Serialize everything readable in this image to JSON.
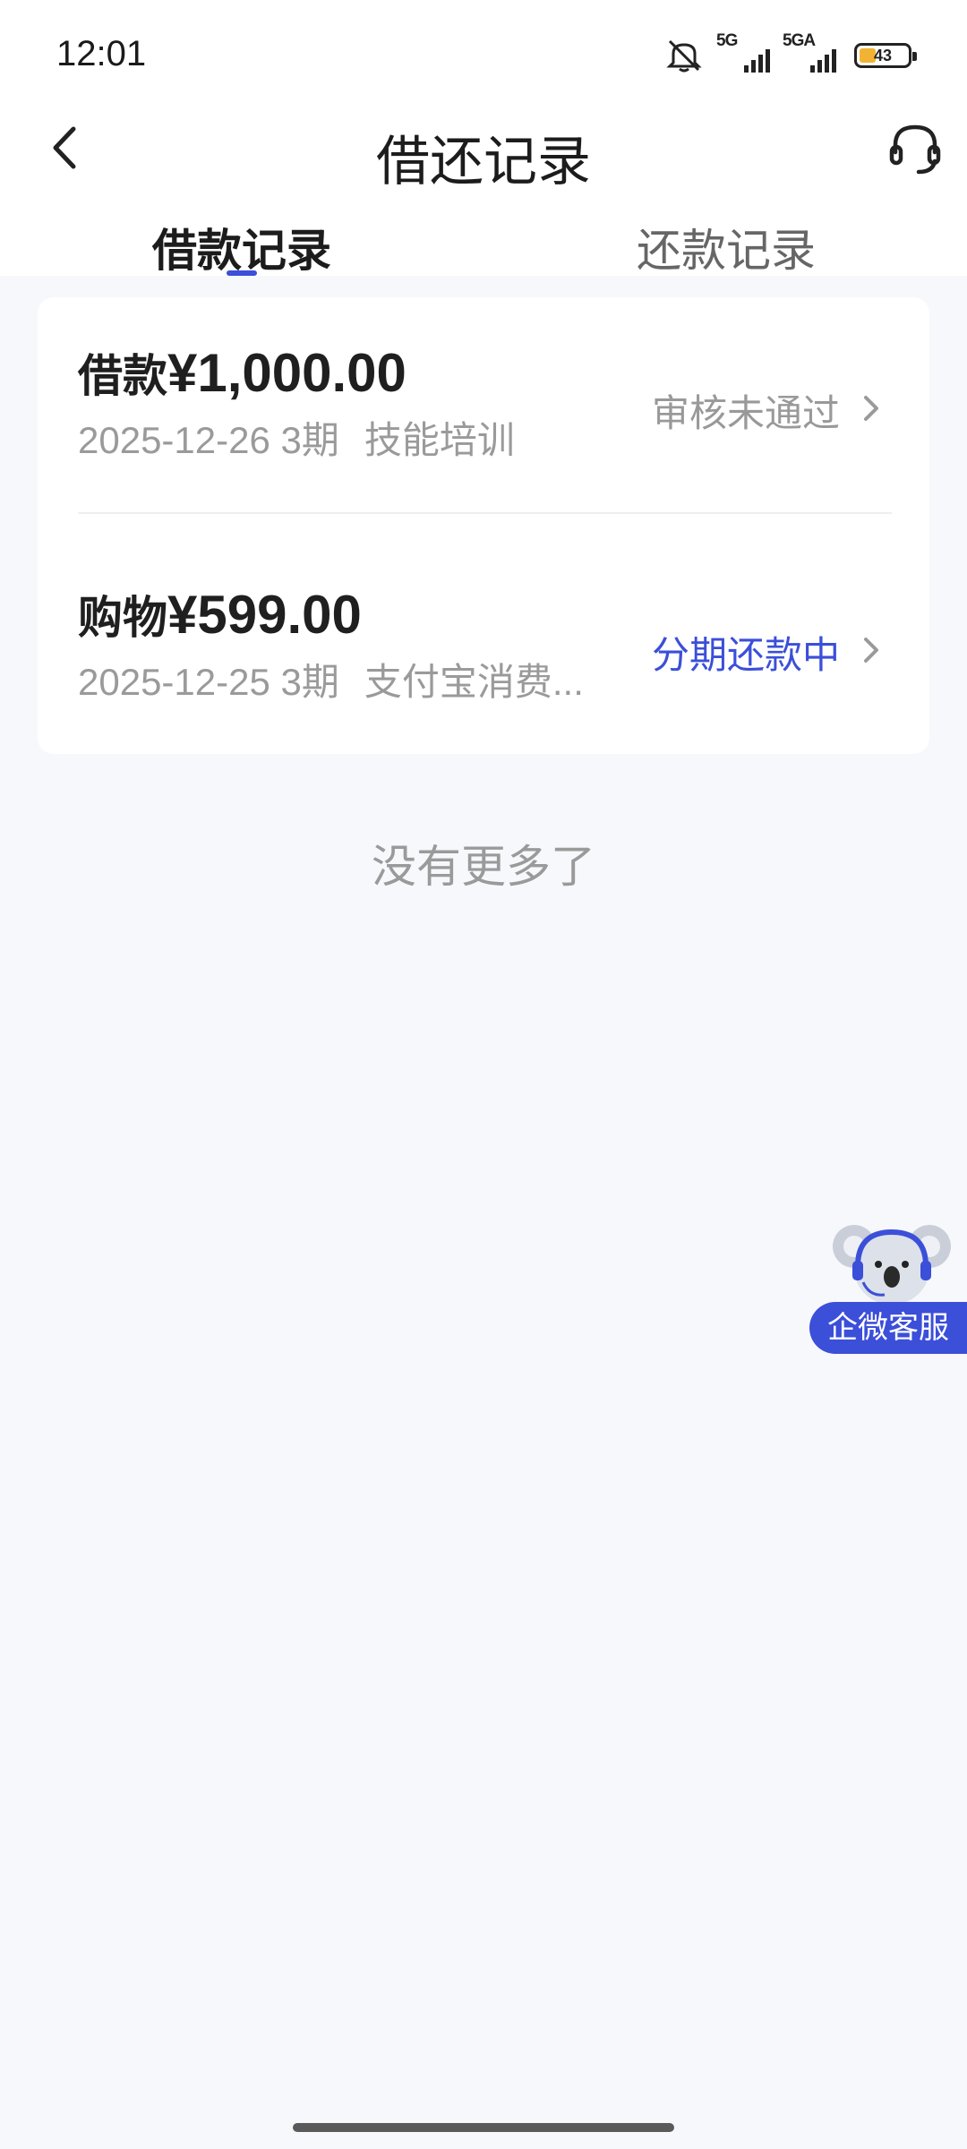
{
  "status_bar": {
    "time": "12:01",
    "network_1": "5G",
    "network_2": "5GA",
    "battery": "43",
    "icons": [
      "mute-icon",
      "signal-icon",
      "battery-icon"
    ]
  },
  "header": {
    "title": "借还记录",
    "back_icon": "chevron-left-icon",
    "service_icon": "headset-icon"
  },
  "tabs": [
    {
      "label": "借款记录",
      "active": true
    },
    {
      "label": "还款记录",
      "active": false
    }
  ],
  "records": [
    {
      "type": "借款",
      "amount": "¥1,000.00",
      "date": "2025-12-26",
      "periods": "3期",
      "purpose": "技能培训",
      "status": "审核未通过",
      "status_color": "#999999"
    },
    {
      "type": "购物",
      "amount": "¥599.00",
      "date": "2025-12-25",
      "periods": "3期",
      "purpose": "支付宝消费...",
      "status": "分期还款中",
      "status_color": "#3b4fd9"
    }
  ],
  "footer_text": "没有更多了",
  "float_service": {
    "label": "企微客服",
    "icon": "koala-mascot-icon"
  },
  "colors": {
    "accent": "#3b4fd9",
    "background": "#f7f8fc"
  }
}
